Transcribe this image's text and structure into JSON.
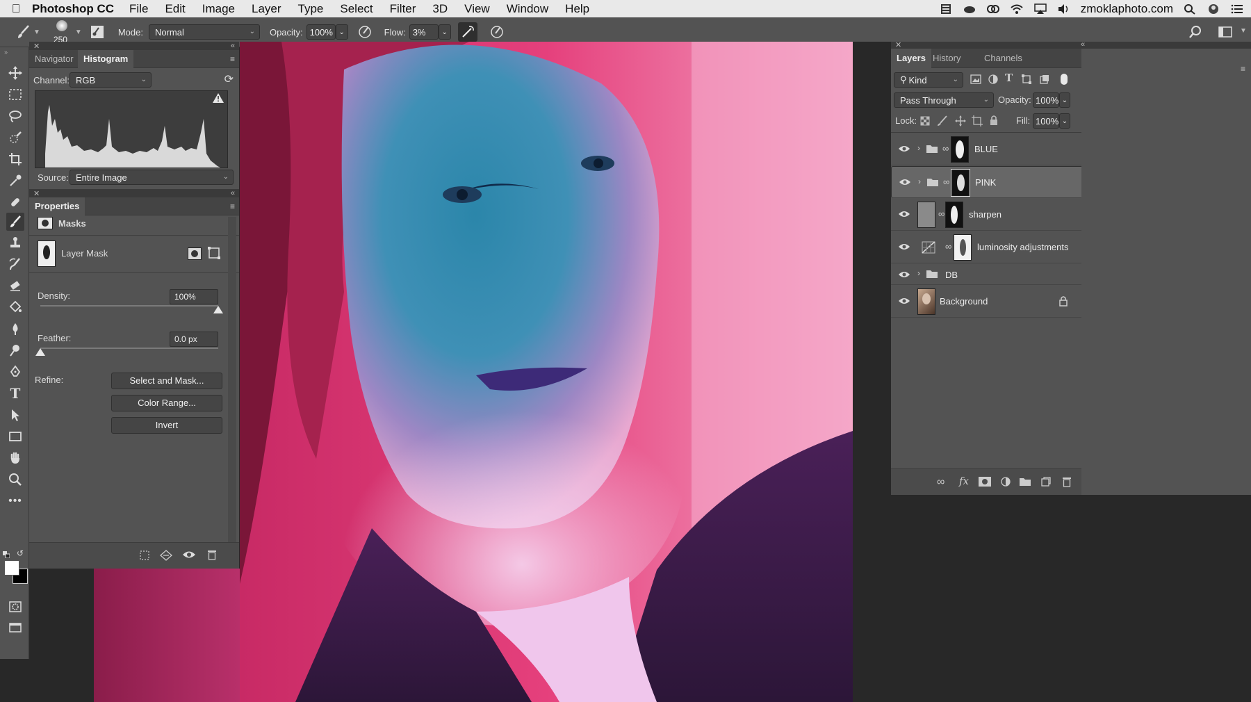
{
  "menubar": {
    "app": "Photoshop CC",
    "items": [
      "File",
      "Edit",
      "Image",
      "Layer",
      "Type",
      "Select",
      "Filter",
      "3D",
      "View",
      "Window",
      "Help"
    ],
    "site": "zmoklaphoto.com"
  },
  "options": {
    "brush_size": "250",
    "mode_label": "Mode:",
    "mode_value": "Normal",
    "opacity_label": "Opacity:",
    "opacity_value": "100%",
    "flow_label": "Flow:",
    "flow_value": "3%"
  },
  "histogram_panel": {
    "tab_navigator": "Navigator",
    "tab_histogram": "Histogram",
    "channel_label": "Channel:",
    "channel_value": "RGB",
    "source_label": "Source:",
    "source_value": "Entire Image"
  },
  "properties_panel": {
    "title": "Properties",
    "section": "Masks",
    "mask_name": "Layer Mask",
    "density_label": "Density:",
    "density_value": "100%",
    "density_level": 1.0,
    "feather_label": "Feather:",
    "feather_value": "0.0 px",
    "feather_level": 0.0,
    "refine_label": "Refine:",
    "select_and_mask": "Select and Mask...",
    "color_range": "Color Range...",
    "invert": "Invert"
  },
  "layers_panel": {
    "tab_layers": "Layers",
    "tab_history": "History",
    "tab_channels": "Channels",
    "kind_value": "Kind",
    "blend_value": "Pass Through",
    "opacity_label": "Opacity:",
    "opacity_value": "100%",
    "lock_label": "Lock:",
    "fill_label": "Fill:",
    "fill_value": "100%",
    "layers": [
      {
        "name": "BLUE"
      },
      {
        "name": "PINK"
      },
      {
        "name": "sharpen"
      },
      {
        "name": "luminosity adjustments"
      },
      {
        "name": "DB"
      },
      {
        "name": "Background"
      }
    ]
  },
  "colors": {
    "panel": "#535353",
    "pink": "#e8477e",
    "blue": "#2f8cb0"
  }
}
